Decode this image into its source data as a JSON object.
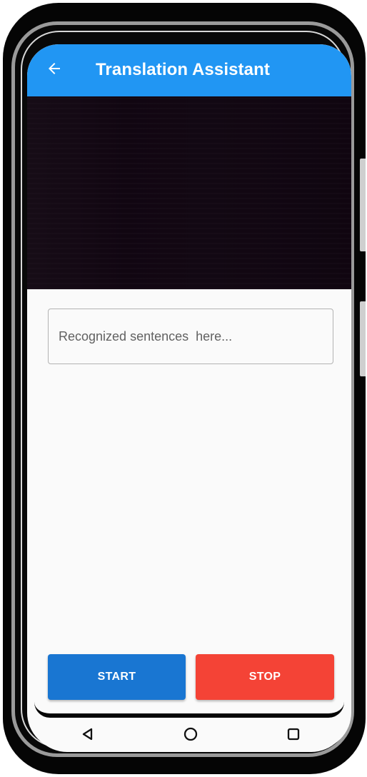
{
  "app_bar": {
    "title": "Translation Assistant",
    "color": "#2196F3",
    "back_icon": "arrow-left-icon"
  },
  "camera_preview": {
    "state": "dark camera preview",
    "background_color": "#120612"
  },
  "recognized_text": {
    "placeholder": "Recognized sentences  here..."
  },
  "actions": {
    "start_label": "START",
    "stop_label": "STOP",
    "start_color": "#1976D2",
    "stop_color": "#F44336"
  },
  "navigation": {
    "back_icon": "triangle-back-icon",
    "home_icon": "circle-home-icon",
    "recents_icon": "square-recents-icon"
  }
}
